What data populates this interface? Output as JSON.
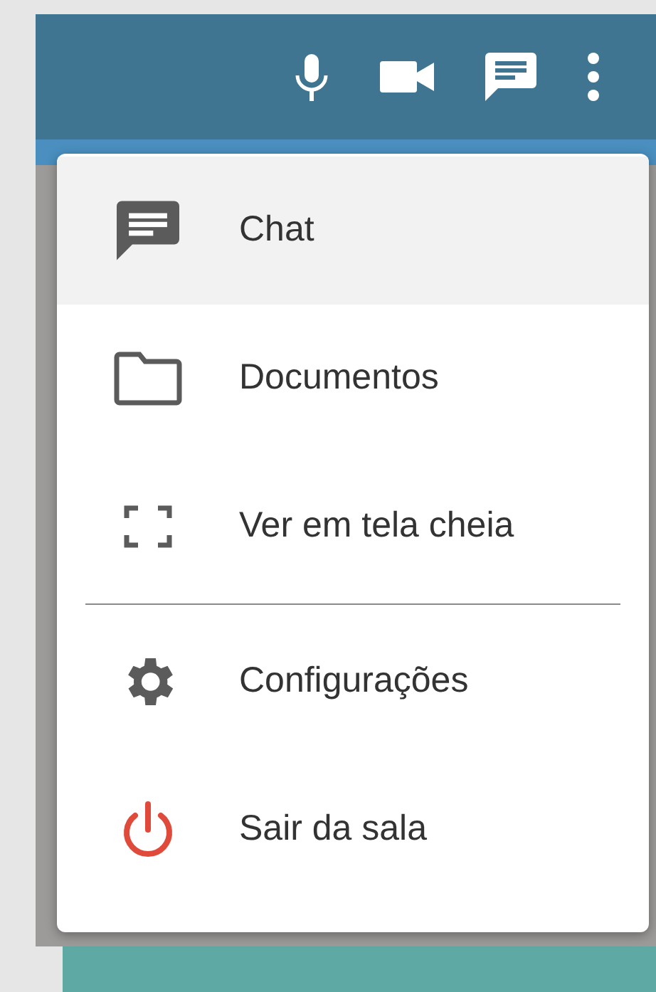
{
  "menu": {
    "groups": [
      [
        {
          "label": "Chat",
          "selected": true
        },
        {
          "label": "Documentos",
          "selected": false
        },
        {
          "label": "Ver em tela cheia",
          "selected": false
        }
      ],
      [
        {
          "label": "Configurações",
          "selected": false
        },
        {
          "label": "Sair da sala",
          "selected": false
        }
      ]
    ]
  }
}
